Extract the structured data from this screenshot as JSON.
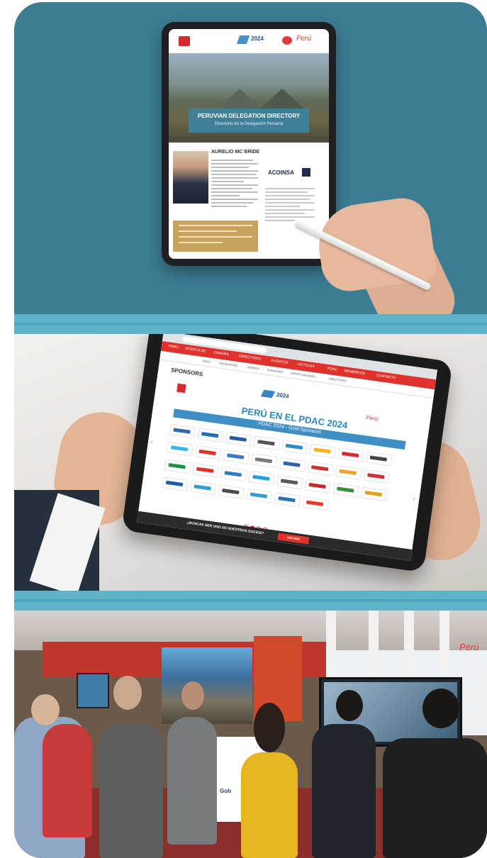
{
  "panel_directory": {
    "doc_title": "PERUVIAN DELEGATION DIRECTORY",
    "doc_subtitle": "Directorio de la Delegación Peruana",
    "logo_pdac_year": "2024",
    "logo_peru": "Perú",
    "profile_name": "AURELIO MC BRIDE",
    "company_logo": "ACOINSA",
    "company_mark": "B+"
  },
  "panel_website": {
    "nav_items": [
      "PERÚ",
      "ACERCA DE",
      "CAMARA",
      "DIRECTORIO",
      "EVENTOS",
      "NOTICIAS",
      "PDAC",
      "MEMBRESÍA",
      "CONTACTO"
    ],
    "sub_nav_items": [
      "PDAC",
      "DELEGACIÓN",
      "AGENDA",
      "SPONSORS",
      "OPORTUNIDADES",
      "DIRECTORIO"
    ],
    "section_label": "SPONSORS",
    "pdac_logo_text": "2024",
    "main_title": "PERÚ EN EL PDAC 2024",
    "band_text": "PDAC 2024 - Gold Sponsors",
    "brand_text": "Perú",
    "sponsor_logos": [
      "sponsor-1",
      "sponsor-2",
      "sponsor-3",
      "sponsor-4",
      "sponsor-5",
      "sponsor-6",
      "sponsor-7",
      "sponsor-8",
      "sponsor-9",
      "sponsor-10",
      "sponsor-11",
      "sponsor-12",
      "sponsor-13",
      "sponsor-14",
      "sponsor-15",
      "sponsor-16",
      "sponsor-17",
      "sponsor-18",
      "sponsor-19",
      "sponsor-20",
      "sponsor-21",
      "sponsor-22",
      "sponsor-23",
      "sponsor-24",
      "sponsor-25",
      "sponsor-26",
      "sponsor-27",
      "sponsor-28",
      "sponsor-29",
      "sponsor-30"
    ],
    "sponsor_colors": [
      "#3366aa",
      "#1f6fb5",
      "#2a5a99",
      "#555555",
      "#2b8cc4",
      "#f2b521",
      "#d9282f",
      "#444444",
      "#3cb4e6",
      "#e0322c",
      "#3a78c2",
      "#7a7a7a",
      "#2f62a8",
      "#cc3333",
      "#f0a030",
      "#c8303a",
      "#1f8f4a",
      "#e0322c",
      "#2b7fc0",
      "#22a0d8",
      "#5a5a5a",
      "#c82a2a",
      "#3a8f3a",
      "#e0a020",
      "#1e5ca8",
      "#2f9fcf",
      "#4d4d4d",
      "#33a0d0",
      "#2b70b8",
      "#e63b2e"
    ],
    "footer_text": "¿BUSCAS SER UNO DE NUESTROS SOCIOS?",
    "footer_button": "VER MÁS"
  },
  "panel_booth": {
    "peru_text": "Perú",
    "counter_text": "Gob"
  }
}
